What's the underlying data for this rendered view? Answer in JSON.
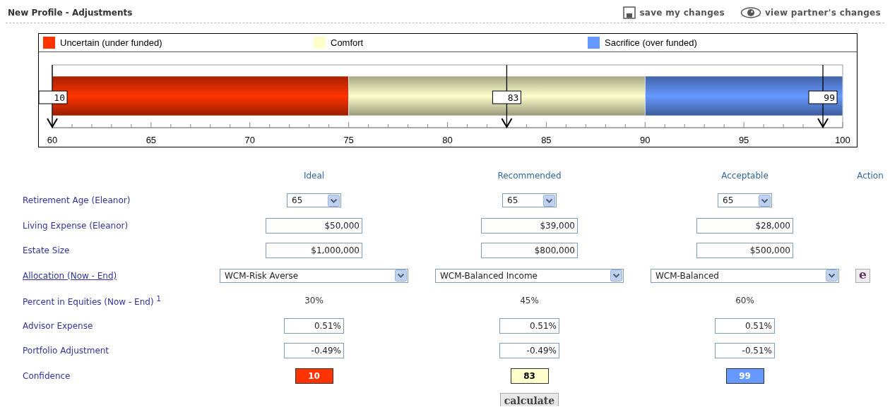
{
  "header": {
    "title": "New Profile - Adjustments",
    "actions": [
      {
        "kind": "save",
        "label": "save my changes"
      },
      {
        "kind": "view",
        "label": "view partner's changes"
      }
    ]
  },
  "funding_scale": {
    "zones": [
      {
        "label": "Uncertain (under funded)",
        "color": "#ff3300"
      },
      {
        "label": "Comfort",
        "color": "#ffffcc"
      },
      {
        "label": "Sacrifice (over funded)",
        "color": "#6699ff"
      }
    ],
    "tick_labels": [
      "60",
      "65",
      "70",
      "75",
      "80",
      "85",
      "90",
      "95",
      "100"
    ],
    "markers": [
      {
        "label": "10",
        "level": 0
      },
      {
        "label": "83",
        "level": 0.575
      },
      {
        "label": "99",
        "level": 0.975
      }
    ]
  },
  "form": {
    "columns": [
      "Ideal",
      "Recommended",
      "Acceptable",
      "Action"
    ],
    "rows": [
      {
        "kind": "select",
        "label": "Retirement Age (Eleanor)",
        "link": false,
        "values": [
          "65",
          "65",
          "65"
        ]
      },
      {
        "kind": "text",
        "label": "Living Expense (Eleanor)",
        "link": false,
        "values": [
          "$50,000",
          "$39,000",
          "$28,000"
        ]
      },
      {
        "kind": "text",
        "label": "Estate Size",
        "link": false,
        "values": [
          "$1,000,000",
          "$800,000",
          "$500,000"
        ]
      },
      {
        "kind": "wide_select",
        "label": "Allocation (Now - End)",
        "link": true,
        "values": [
          "WCM-Risk Averse",
          "WCM-Balanced Income",
          "WCM-Balanced"
        ],
        "action": "e"
      },
      {
        "kind": "static",
        "label": "Percent in Equities (Now - End) $^{1}$",
        "link": false,
        "values": [
          "30%",
          "45%",
          "60%"
        ]
      },
      {
        "kind": "short_text",
        "label": "Advisor Expense",
        "link": false,
        "values": [
          "0.51%",
          "0.51%",
          "0.51%"
        ]
      },
      {
        "kind": "short_text",
        "label": "Portfolio Adjustment",
        "link": false,
        "values": [
          "-0.49%",
          "-0.49%",
          "-0.51%"
        ]
      },
      {
        "kind": "confidence",
        "label": "Confidence",
        "link": false,
        "values": [
          {
            "text": "10",
            "color": "#ff3300"
          },
          {
            "text": "83",
            "color": "#ffffcc"
          },
          {
            "text": "99",
            "color": "#6699ff"
          }
        ]
      }
    ],
    "calculate": "calculate"
  }
}
